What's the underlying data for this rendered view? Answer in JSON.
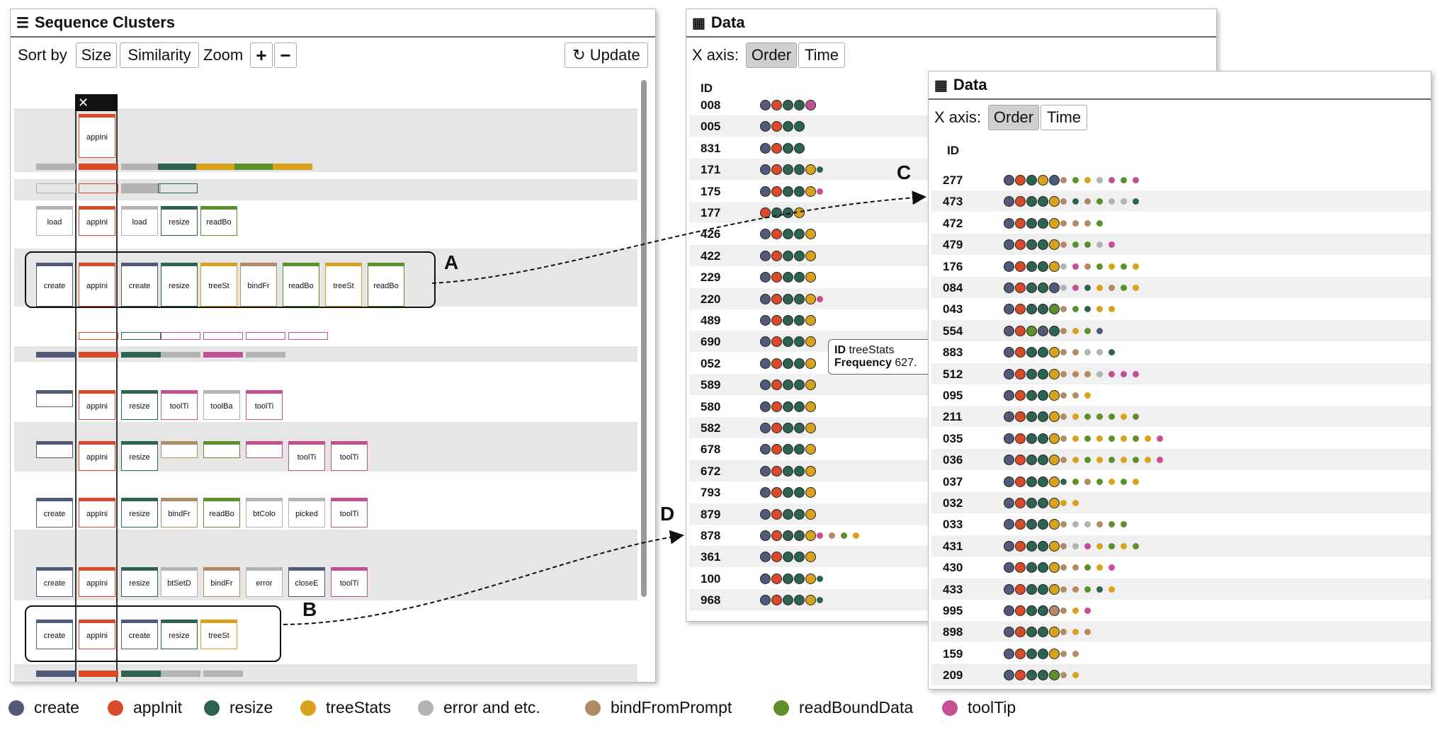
{
  "left_panel": {
    "title": "Sequence Clusters",
    "icon": "list-icon",
    "sort_label": "Sort by",
    "sort_size": "Size",
    "sort_similarity": "Similarity",
    "zoom_label": "Zoom",
    "zoom_in": "+",
    "zoom_out": "−",
    "update": "Update",
    "close": "✕",
    "callout_a": "A",
    "callout_b": "B",
    "clusters": [
      {
        "boxes": [
          "appIni"
        ]
      },
      {
        "boxes": [
          "load",
          "appIni",
          "load",
          "resize",
          "readBo"
        ]
      },
      {
        "boxes": [
          "create",
          "appIni",
          "create",
          "resize",
          "treeSt",
          "bindFr",
          "readBo",
          "treeSt",
          "readBo"
        ]
      },
      {
        "boxes": [
          "",
          "appIni",
          "resize",
          "toolTi",
          "toolBa",
          "toolTi"
        ]
      },
      {
        "boxes": [
          "",
          "appIni",
          "resize",
          "",
          "",
          "",
          "toolTi",
          "toolTi"
        ]
      },
      {
        "boxes": [
          "create",
          "appIni",
          "resize",
          "bindFr",
          "readBo",
          "btColo",
          "picked",
          "toolTi"
        ]
      },
      {
        "boxes": [
          "create",
          "appIni",
          "resize",
          "btSetD",
          "bindFr",
          "error",
          "closeE",
          "toolTi"
        ]
      },
      {
        "boxes": [
          "create",
          "appIni",
          "create",
          "resize",
          "treeSt"
        ]
      }
    ]
  },
  "data_panel_1": {
    "title": "Data",
    "icon": "table-icon",
    "xaxis_label": "X axis:",
    "order": "Order",
    "time": "Time",
    "id_header": "ID",
    "callout_d": "D",
    "tooltip_id_label": "ID",
    "tooltip_id": "treeStats",
    "tooltip_freq_label": "Frequency",
    "tooltip_freq": "627.",
    "rows": [
      "008",
      "005",
      "831",
      "171",
      "175",
      "177",
      "426",
      "422",
      "229",
      "220",
      "489",
      "690",
      "052",
      "589",
      "580",
      "582",
      "678",
      "672",
      "793",
      "879",
      "878",
      "361",
      "100",
      "968"
    ]
  },
  "data_panel_2": {
    "title": "Data",
    "icon": "table-icon",
    "xaxis_label": "X axis:",
    "order": "Order",
    "time": "Time",
    "id_header": "ID",
    "callout_c": "C",
    "rows": [
      "277",
      "473",
      "472",
      "479",
      "176",
      "084",
      "043",
      "554",
      "883",
      "512",
      "095",
      "211",
      "035",
      "036",
      "037",
      "032",
      "033",
      "431",
      "430",
      "433",
      "995",
      "898",
      "159",
      "209"
    ]
  },
  "legend": [
    {
      "label": "create",
      "color": "#535a78"
    },
    {
      "label": "appInit",
      "color": "#d9492a"
    },
    {
      "label": "resize",
      "color": "#2e6352"
    },
    {
      "label": "treeStats",
      "color": "#d9a21c"
    },
    {
      "label": "error and etc.",
      "color": "#b3b3b3"
    },
    {
      "label": "bindFromPrompt",
      "color": "#b08b63"
    },
    {
      "label": "readBoundData",
      "color": "#5e8f2d"
    },
    {
      "label": "toolTip",
      "color": "#c44f94"
    }
  ]
}
